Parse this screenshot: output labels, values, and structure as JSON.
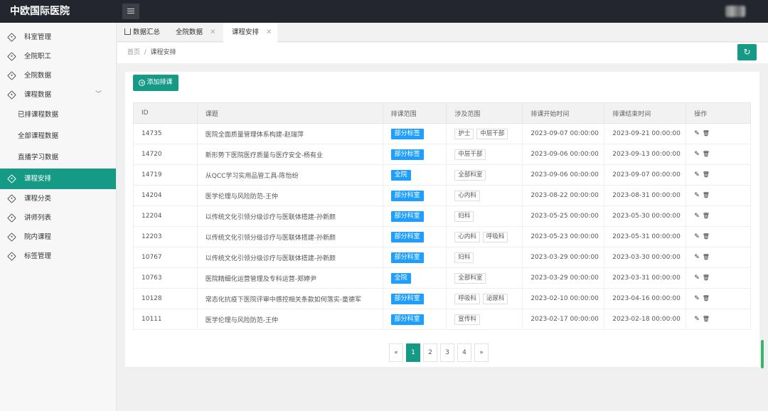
{
  "header": {
    "brand": "中欧国际医院",
    "menu_icon": "hamburger-icon"
  },
  "sidebar": {
    "items": [
      {
        "label": "科室管理"
      },
      {
        "label": "全院职工"
      },
      {
        "label": "全院数据"
      },
      {
        "label": "课程数据",
        "chevron": "﹀"
      },
      {
        "label": "已排课程数据",
        "sub": true
      },
      {
        "label": "全部课程数据",
        "sub": true
      },
      {
        "label": "直播学习数据",
        "sub": true
      },
      {
        "label": "课程安排",
        "active": true
      },
      {
        "label": "课程分类"
      },
      {
        "label": "讲师列表"
      },
      {
        "label": "院内课程"
      },
      {
        "label": "标签管理"
      }
    ]
  },
  "tabs": [
    {
      "label": "数据汇总"
    },
    {
      "label": "全院数据",
      "close": "✕"
    },
    {
      "label": "课程安排",
      "close": "✕",
      "active": true
    }
  ],
  "breadcrumb": {
    "home": "首页",
    "sep": "/",
    "current": "课程安排"
  },
  "toolbar": {
    "add_label": "添加排课",
    "refresh_icon": "↻"
  },
  "table": {
    "columns": [
      "ID",
      "课题",
      "排课范围",
      "涉及范围",
      "排课开始时间",
      "排课结束时间",
      "操作"
    ],
    "rows": [
      {
        "id": "14735",
        "title": "医院全面质量管理体系构建-赵瑞萍",
        "scope": "部分标签",
        "tags": [
          "护士",
          "中层干部"
        ],
        "start": "2023-09-07 00:00:00",
        "end": "2023-09-21 00:00:00"
      },
      {
        "id": "14720",
        "title": "新形势下医院医疗质量与医疗安全-杨有业",
        "scope": "部分标签",
        "tags": [
          "中层干部"
        ],
        "start": "2023-09-06 00:00:00",
        "end": "2023-09-13 00:00:00"
      },
      {
        "id": "14719",
        "title": "从QCC学习实用品管工具-陈怡纷",
        "scope": "全院",
        "tags": [
          "全部科室"
        ],
        "start": "2023-09-06 00:00:00",
        "end": "2023-09-07 00:00:00"
      },
      {
        "id": "14204",
        "title": "医学伦理与风险防范-王仲",
        "scope": "部分科室",
        "tags": [
          "心内科"
        ],
        "start": "2023-08-22 00:00:00",
        "end": "2023-08-31 00:00:00"
      },
      {
        "id": "12204",
        "title": "以传统文化引领分级诊疗与医联体搭建-孙新颜",
        "scope": "部分科室",
        "tags": [
          "妇科"
        ],
        "start": "2023-05-25 00:00:00",
        "end": "2023-05-30 00:00:00"
      },
      {
        "id": "12203",
        "title": "以传统文化引领分级诊疗与医联体搭建-孙新颜",
        "scope": "部分科室",
        "tags": [
          "心内科",
          "呼吸科"
        ],
        "start": "2023-05-23 00:00:00",
        "end": "2023-05-31 00:00:00"
      },
      {
        "id": "10767",
        "title": "以传统文化引领分级诊疗与医联体搭建-孙新颜",
        "scope": "部分科室",
        "tags": [
          "妇科"
        ],
        "start": "2023-03-29 00:00:00",
        "end": "2023-03-30 00:00:00"
      },
      {
        "id": "10763",
        "title": "医院精细化运营管理及专科运营-郑婷尹",
        "scope": "全院",
        "tags": [
          "全部科室"
        ],
        "start": "2023-03-29 00:00:00",
        "end": "2023-03-31 00:00:00"
      },
      {
        "id": "10128",
        "title": "常态化抗疫下医院评审中感控相关条款如何落实-童德军",
        "scope": "部分科室",
        "tags": [
          "呼吸科",
          "泌尿科"
        ],
        "start": "2023-02-10 00:00:00",
        "end": "2023-04-16 00:00:00"
      },
      {
        "id": "10111",
        "title": "医学伦理与风险防范-王仲",
        "scope": "部分科室",
        "tags": [
          "宣传科"
        ],
        "start": "2023-02-17 00:00:00",
        "end": "2023-02-18 00:00:00"
      }
    ],
    "op_edit_icon": "✎",
    "op_delete_icon": "🗑"
  },
  "pagination": {
    "prev": "«",
    "pages": [
      "1",
      "2",
      "3",
      "4"
    ],
    "current": "1",
    "next": "»"
  }
}
